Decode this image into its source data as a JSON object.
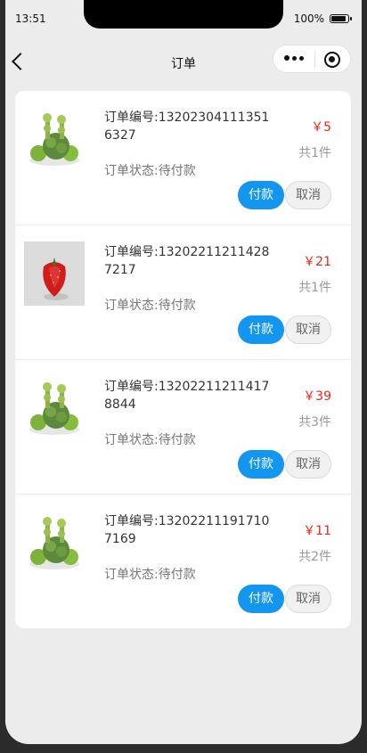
{
  "status_bar": {
    "time": "13:51",
    "battery": "100%"
  },
  "navbar": {
    "title": "订单"
  },
  "orders": [
    {
      "id_text": "订单编号:132023041113516327",
      "status": "订单状态:待付款",
      "price": "￥5",
      "count": "共1件",
      "pay_label": "付款",
      "cancel_label": "取消",
      "image": "vegetable-bundle"
    },
    {
      "id_text": "订单编号:132022112114287217",
      "status": "订单状态:待付款",
      "price": "￥21",
      "count": "共1件",
      "pay_label": "付款",
      "cancel_label": "取消",
      "image": "strawberry"
    },
    {
      "id_text": "订单编号:132022112114178844",
      "status": "订单状态:待付款",
      "price": "￥39",
      "count": "共3件",
      "pay_label": "付款",
      "cancel_label": "取消",
      "image": "vegetable-bundle"
    },
    {
      "id_text": "订单编号:132022111917107169",
      "status": "订单状态:待付款",
      "price": "￥11",
      "count": "共2件",
      "pay_label": "付款",
      "cancel_label": "取消",
      "image": "vegetable-bundle"
    }
  ],
  "colors": {
    "accent": "#1296f0",
    "price": "#e8281a",
    "background": "#ececec"
  }
}
